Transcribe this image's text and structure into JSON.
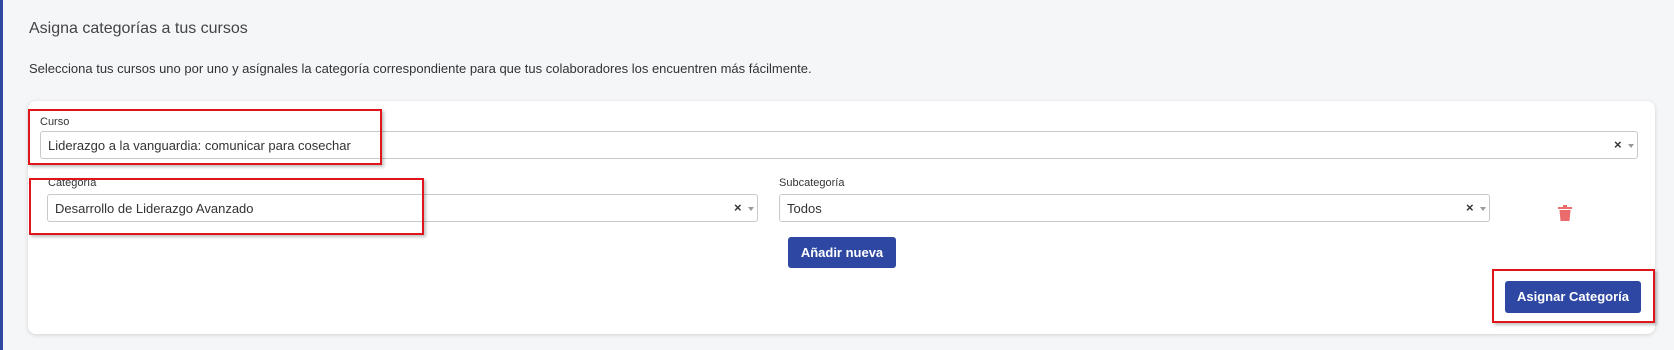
{
  "page": {
    "title": "Asigna categorías a tus cursos",
    "description": "Selecciona tus cursos uno por uno y asígnales la categoría correspondiente para que tus colaboradores los encuentren más fácilmente."
  },
  "form": {
    "curso": {
      "label": "Curso",
      "value": "Liderazgo a la vanguardia: comunicar para cosechar",
      "clear": "×"
    },
    "categoria": {
      "label": "Categoría",
      "value": "Desarrollo de Liderazgo Avanzado",
      "clear": "×"
    },
    "subcategoria": {
      "label": "Subcategoría",
      "value": "Todos",
      "clear": "×"
    },
    "add_button": "Añadir nueva",
    "delete_icon": "trash-icon",
    "submit_button": "Asignar Categoría"
  },
  "colors": {
    "primary": "#2d47a3",
    "danger_icon": "#e96b6b",
    "highlight": "#e0141b"
  }
}
